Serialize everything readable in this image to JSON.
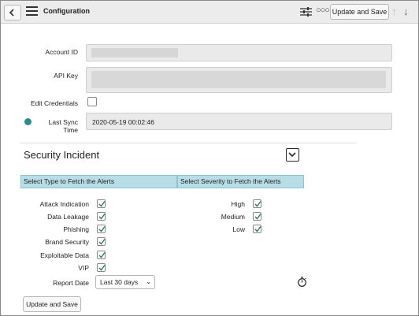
{
  "header": {
    "title": "Configuration",
    "update_label": "Update and Save"
  },
  "form": {
    "account_id_label": "Account ID",
    "api_key_label": "API Key",
    "edit_credentials_label": "Edit Credentials",
    "last_sync_label": "Last Sync Time",
    "last_sync_value": "2020-05-19 00:02:46"
  },
  "section": {
    "title": "Security Incident",
    "type_bar": "Select Type to Fetch the Alerts",
    "severity_bar": "Select Severity to Fetch the Alerts",
    "types": [
      {
        "label": "Attack Indication",
        "checked": true
      },
      {
        "label": "Data Leakage",
        "checked": true
      },
      {
        "label": "Phishing",
        "checked": true
      },
      {
        "label": "Brand Security",
        "checked": true
      },
      {
        "label": "Exploitable Data",
        "checked": true
      },
      {
        "label": "VIP",
        "checked": true
      }
    ],
    "severities": [
      {
        "label": "High",
        "checked": true
      },
      {
        "label": "Medium",
        "checked": true
      },
      {
        "label": "Low",
        "checked": true
      }
    ],
    "report_date_label": "Report Date",
    "report_date_value": "Last 30 days"
  },
  "footer": {
    "update_label": "Update and Save"
  }
}
